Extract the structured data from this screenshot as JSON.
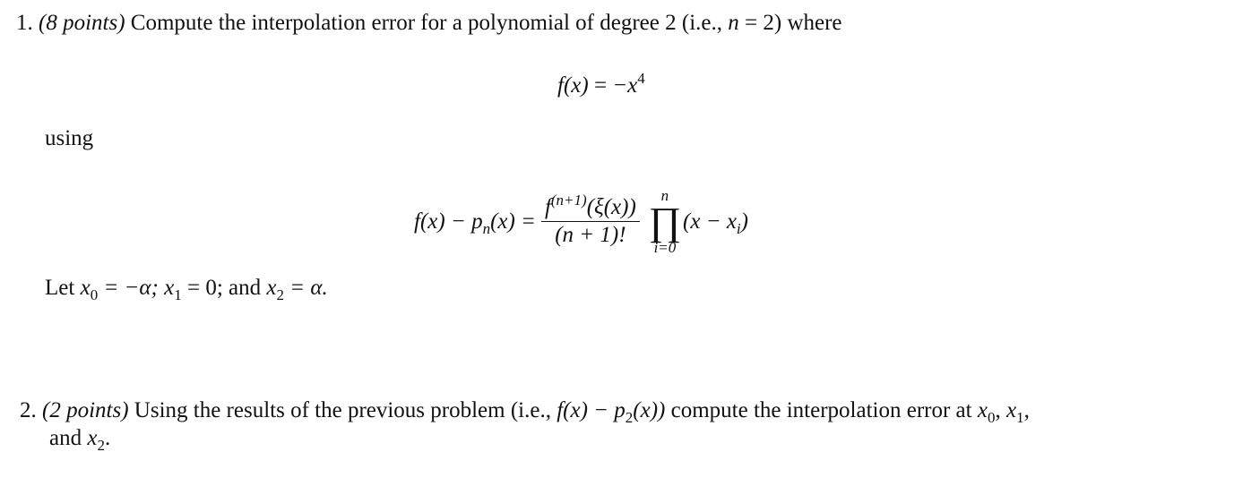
{
  "problems": [
    {
      "number": "1.",
      "points": "(8 points)",
      "text_before": "Compute the interpolation error for a polynomial of degree 2 (i.e.,",
      "n_var": "n",
      "n_eq": " = 2)",
      "text_after": "where",
      "equation1": {
        "lhs": "f(x)",
        "eq": " = ",
        "rhs_base": "−x",
        "rhs_exp": "4"
      },
      "using": "using",
      "equation2": {
        "lhs": "f(x) − p",
        "lhs_sub": "n",
        "lhs_tail": "(x) =",
        "num_f": "f",
        "num_sup": "(n+1)",
        "num_tail": "(ξ(x))",
        "den": "(n + 1)!",
        "prod_upper": "n",
        "prod_symbol": "∏",
        "prod_lower": "i=0",
        "factor": "(x − x",
        "factor_sub": "i",
        "factor_close": ")"
      },
      "let": {
        "word": "Let",
        "x0": "x",
        "x0_sub": "0",
        "x0_val": " = −α;",
        "x1": "x",
        "x1_sub": "1",
        "x1_val": " = 0;",
        "and": "and",
        "x2": "x",
        "x2_sub": "2",
        "x2_val": " = α."
      }
    },
    {
      "number": "2.",
      "points": "(2 points)",
      "text_before": "Using the results of the previous problem (i.e.,",
      "expr": "f(x) − p",
      "expr_sub": "2",
      "expr_tail": "(x))",
      "text_after": "compute the interpolation error at",
      "x0": "x",
      "x0_sub": "0",
      "x1": "x",
      "x1_sub": "1",
      "and": "and",
      "x2": "x",
      "x2_sub": "2",
      "end": "."
    }
  ]
}
